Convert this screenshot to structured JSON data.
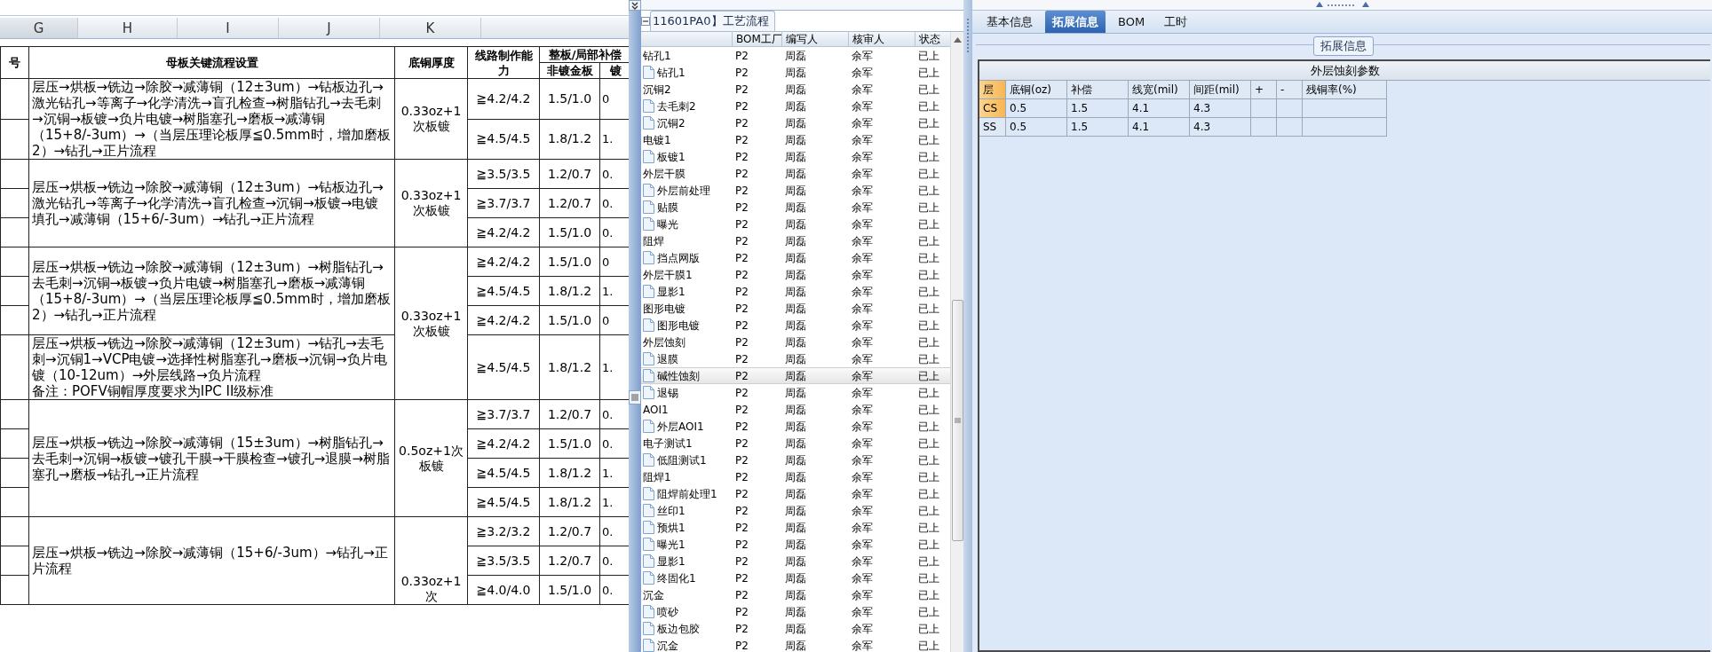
{
  "spreadsheet": {
    "column_letters": [
      "G",
      "H",
      "I",
      "J",
      "K"
    ],
    "headers": {
      "column_1": "号",
      "process": "母板关键流程设置",
      "base_copper": "底铜厚度",
      "line_capability": "线路制作能力",
      "compensation": "整板/局部补偿",
      "non_gold": "非镀金板",
      "column_6": "镀"
    },
    "copper_blocks": [
      {
        "base_copper": "0.33oz+1次板镀",
        "flows": [
          {
            "text": "层压→烘板→铣边→除胶→减薄铜（12±3um）→钻板边孔→激光钻孔→等离子→化学清洗→盲孔检查→树脂钻孔→去毛刺→沉铜→板镀→负片电镀→树脂塞孔→磨板→减薄铜（15+8/-3um）→（当层压理论板厚≦0.5mm时，增加磨板2）→钻孔→正片流程",
            "rows": [
              {
                "capability": "≧4.2/4.2",
                "non_gold": "1.5/1.0",
                "column_6": "0"
              },
              {
                "capability": "≧4.5/4.5",
                "non_gold": "1.8/1.2",
                "column_6": "1."
              }
            ]
          }
        ]
      },
      {
        "base_copper": "0.33oz+1次板镀",
        "flows": [
          {
            "text": "层压→烘板→铣边→除胶→减薄铜（12±3um）→钻板边孔→激光钻孔→等离子→化学清洗→盲孔检查→沉铜→板镀→电镀填孔→减薄铜（15+6/-3um）→钻孔→正片流程",
            "rows": [
              {
                "capability": "≧3.5/3.5",
                "non_gold": "1.2/0.7",
                "column_6": "0."
              },
              {
                "capability": "≧3.7/3.7",
                "non_gold": "1.2/0.7",
                "column_6": "0."
              },
              {
                "capability": "≧4.2/4.2",
                "non_gold": "1.5/1.0",
                "column_6": "0."
              }
            ]
          }
        ]
      },
      {
        "base_copper": "0.33oz+1次板镀",
        "flows": [
          {
            "text": "层压→烘板→铣边→除胶→减薄铜（12±3um）→树脂钻孔→去毛刺→沉铜→板镀→负片电镀→树脂塞孔→磨板→减薄铜（15+8/-3um）→（当层压理论板厚≦0.5mm时，增加磨板2）→钻孔→正片流程",
            "rows": [
              {
                "capability": "≧4.2/4.2",
                "non_gold": "1.5/1.0",
                "column_6": "0"
              },
              {
                "capability": "≧4.5/4.5",
                "non_gold": "1.8/1.2",
                "column_6": "1."
              },
              {
                "capability": "≧4.2/4.2",
                "non_gold": "1.5/1.0",
                "column_6": "0"
              }
            ]
          },
          {
            "text": "层压→烘板→铣边→除胶→减薄铜（12±3um）→钻孔→去毛刺→沉铜1→VCP电镀→选择性树脂塞孔→磨板→沉铜→负片电镀（10-12um）→外层线路→负片流程",
            "note": "备注：POFV铜帽厚度要求为IPC II级标准",
            "rows": [
              {
                "capability": "≧4.5/4.5",
                "non_gold": "1.8/1.2",
                "column_6": "1."
              }
            ]
          }
        ]
      },
      {
        "base_copper": "0.5oz+1次板镀",
        "flows": [
          {
            "text": "层压→烘板→铣边→除胶→减薄铜（15±3um）→树脂钻孔→去毛刺→沉铜→板镀→镀孔干膜→干膜检查→镀孔→退膜→树脂塞孔→磨板→钻孔→正片流程",
            "rows": [
              {
                "capability": "≧3.7/3.7",
                "non_gold": "1.2/0.7",
                "column_6": "0."
              },
              {
                "capability": "≧4.2/4.2",
                "non_gold": "1.5/1.0",
                "column_6": "0."
              },
              {
                "capability": "≧4.5/4.5",
                "non_gold": "1.8/1.2",
                "column_6": "1."
              },
              {
                "capability": "≧4.5/4.5",
                "non_gold": "1.8/1.2",
                "column_6": "1."
              }
            ]
          }
        ]
      },
      {
        "base_copper": "0.33oz+1次",
        "flows": [
          {
            "text": "层压→烘板→铣边→除胶→减薄铜（15+6/-3um）→钻孔→正片流程",
            "rows": [
              {
                "capability": "≧3.2/3.2",
                "non_gold": "1.2/0.7",
                "column_6": "0."
              },
              {
                "capability": "≧3.5/3.5",
                "non_gold": "1.2/0.7",
                "column_6": "0."
              },
              {
                "capability": "≧4.0/4.0",
                "non_gold": "1.5/1.0",
                "column_6": "0."
              }
            ]
          }
        ]
      }
    ]
  },
  "process_panel": {
    "title": "11601PA0】工艺流程",
    "columns": [
      "BOM工厂",
      "编写人",
      "核审人",
      "状态"
    ],
    "steps": [
      {
        "name": "钻孔1",
        "factory": "P2",
        "writer": "周磊",
        "reviewer": "余军",
        "status": "已上",
        "selected": false,
        "children": [
          {
            "name": "钻孔1",
            "factory": "P2",
            "writer": "周磊",
            "reviewer": "余军",
            "status": "已上",
            "selected": false
          }
        ]
      },
      {
        "name": "沉铜2",
        "factory": "P2",
        "writer": "周磊",
        "reviewer": "余军",
        "status": "已上",
        "selected": false,
        "children": [
          {
            "name": "去毛刺2",
            "factory": "P2",
            "writer": "周磊",
            "reviewer": "余军",
            "status": "已上",
            "selected": false
          },
          {
            "name": "沉铜2",
            "factory": "P2",
            "writer": "周磊",
            "reviewer": "余军",
            "status": "已上",
            "selected": false
          }
        ]
      },
      {
        "name": "电镀1",
        "factory": "P2",
        "writer": "周磊",
        "reviewer": "余军",
        "status": "已上",
        "selected": false,
        "children": [
          {
            "name": "板镀1",
            "factory": "P2",
            "writer": "周磊",
            "reviewer": "余军",
            "status": "已上",
            "selected": false
          }
        ]
      },
      {
        "name": "外层干膜",
        "factory": "P2",
        "writer": "周磊",
        "reviewer": "余军",
        "status": "已上",
        "selected": false,
        "children": [
          {
            "name": "外层前处理",
            "factory": "P2",
            "writer": "周磊",
            "reviewer": "余军",
            "status": "已上",
            "selected": false
          },
          {
            "name": "贴膜",
            "factory": "P2",
            "writer": "周磊",
            "reviewer": "余军",
            "status": "已上",
            "selected": false
          },
          {
            "name": "曝光",
            "factory": "P2",
            "writer": "周磊",
            "reviewer": "余军",
            "status": "已上",
            "selected": false
          }
        ]
      },
      {
        "name": "阻焊",
        "factory": "P2",
        "writer": "周磊",
        "reviewer": "余军",
        "status": "已上",
        "selected": false,
        "children": [
          {
            "name": "挡点网版",
            "factory": "P2",
            "writer": "周磊",
            "reviewer": "余军",
            "status": "已上",
            "selected": false
          }
        ]
      },
      {
        "name": "外层干膜1",
        "factory": "P2",
        "writer": "周磊",
        "reviewer": "余军",
        "status": "已上",
        "selected": false,
        "children": [
          {
            "name": "显影1",
            "factory": "P2",
            "writer": "周磊",
            "reviewer": "余军",
            "status": "已上",
            "selected": false
          }
        ]
      },
      {
        "name": "图形电镀",
        "factory": "P2",
        "writer": "周磊",
        "reviewer": "余军",
        "status": "已上",
        "selected": false,
        "children": [
          {
            "name": "图形电镀",
            "factory": "P2",
            "writer": "周磊",
            "reviewer": "余军",
            "status": "已上",
            "selected": false
          }
        ]
      },
      {
        "name": "外层蚀刻",
        "factory": "P2",
        "writer": "周磊",
        "reviewer": "余军",
        "status": "已上",
        "selected": false,
        "children": [
          {
            "name": "退膜",
            "factory": "P2",
            "writer": "周磊",
            "reviewer": "余军",
            "status": "已上",
            "selected": false
          },
          {
            "name": "碱性蚀刻",
            "factory": "P2",
            "writer": "周磊",
            "reviewer": "余军",
            "status": "已上",
            "selected": true
          },
          {
            "name": "退锡",
            "factory": "P2",
            "writer": "周磊",
            "reviewer": "余军",
            "status": "已上",
            "selected": false
          }
        ]
      },
      {
        "name": "AOI1",
        "factory": "P2",
        "writer": "周磊",
        "reviewer": "余军",
        "status": "已上",
        "selected": false,
        "children": [
          {
            "name": "外层AOI1",
            "factory": "P2",
            "writer": "周磊",
            "reviewer": "余军",
            "status": "已上",
            "selected": false
          }
        ]
      },
      {
        "name": "电子测试1",
        "factory": "P2",
        "writer": "周磊",
        "reviewer": "余军",
        "status": "已上",
        "selected": false,
        "children": [
          {
            "name": "低阻测试1",
            "factory": "P2",
            "writer": "周磊",
            "reviewer": "余军",
            "status": "已上",
            "selected": false
          }
        ]
      },
      {
        "name": "阻焊1",
        "factory": "P2",
        "writer": "周磊",
        "reviewer": "余军",
        "status": "已上",
        "selected": false,
        "children": [
          {
            "name": "阻焊前处理1",
            "factory": "P2",
            "writer": "周磊",
            "reviewer": "余军",
            "status": "已上",
            "selected": false
          },
          {
            "name": "丝印1",
            "factory": "P2",
            "writer": "周磊",
            "reviewer": "余军",
            "status": "已上",
            "selected": false
          },
          {
            "name": "预烘1",
            "factory": "P2",
            "writer": "周磊",
            "reviewer": "余军",
            "status": "已上",
            "selected": false
          },
          {
            "name": "曝光1",
            "factory": "P2",
            "writer": "周磊",
            "reviewer": "余军",
            "status": "已上",
            "selected": false
          },
          {
            "name": "显影1",
            "factory": "P2",
            "writer": "周磊",
            "reviewer": "余军",
            "status": "已上",
            "selected": false
          },
          {
            "name": "终固化1",
            "factory": "P2",
            "writer": "周磊",
            "reviewer": "余军",
            "status": "已上",
            "selected": false
          }
        ]
      },
      {
        "name": "沉金",
        "factory": "P2",
        "writer": "周磊",
        "reviewer": "余军",
        "status": "已上",
        "selected": false,
        "children": [
          {
            "name": "喷砂",
            "factory": "P2",
            "writer": "周磊",
            "reviewer": "余军",
            "status": "已上",
            "selected": false
          },
          {
            "name": "板边包胶",
            "factory": "P2",
            "writer": "周磊",
            "reviewer": "余军",
            "status": "已上",
            "selected": false
          },
          {
            "name": "沉金",
            "factory": "P2",
            "writer": "周磊",
            "reviewer": "余军",
            "status": "已上",
            "selected": false
          }
        ]
      }
    ]
  },
  "detail_panel": {
    "tabs": [
      {
        "label": "基本信息",
        "selected": false
      },
      {
        "label": "拓展信息",
        "selected": true
      },
      {
        "label": "BOM",
        "selected": false
      },
      {
        "label": "工时",
        "selected": false
      }
    ],
    "group_title": "拓展信息",
    "grid": {
      "title": "外层蚀刻参数",
      "columns": [
        "层",
        "底铜(oz)",
        "补偿",
        "线宽(mil)",
        "间距(mil)",
        "+",
        "-",
        "残铜率(%)"
      ],
      "rows": [
        {
          "selected": true,
          "cells": [
            "CS",
            "0.5",
            "1.5",
            "4.1",
            "4.3"
          ]
        },
        {
          "selected": false,
          "cells": [
            "SS",
            "0.5",
            "1.5",
            "4.1",
            "4.3"
          ]
        }
      ]
    }
  }
}
